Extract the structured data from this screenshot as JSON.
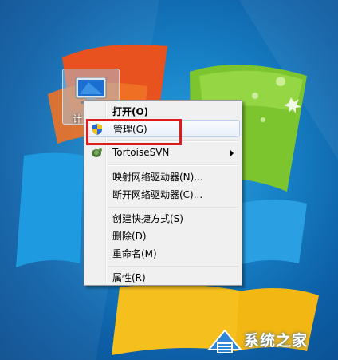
{
  "desktop": {
    "icon_label": "计"
  },
  "context_menu": {
    "items": [
      {
        "label": "打开(O)",
        "bold": true
      },
      {
        "label": "管理(G)",
        "icon": "shield-icon"
      },
      {
        "label": "TortoiseSVN",
        "icon": "tortoise-svn-icon",
        "submenu": true
      },
      {
        "label": "映射网络驱动器(N)..."
      },
      {
        "label": "断开网络驱动器(C)..."
      },
      {
        "label": "创建快捷方式(S)"
      },
      {
        "label": "删除(D)"
      },
      {
        "label": "重命名(M)"
      },
      {
        "label": "属性(R)"
      }
    ]
  },
  "watermark": {
    "text": "系统之家"
  },
  "colors": {
    "highlight_box": "#e11b1b",
    "menu_background": "#f0f0f0",
    "desktop_blue": "#1883c8"
  }
}
